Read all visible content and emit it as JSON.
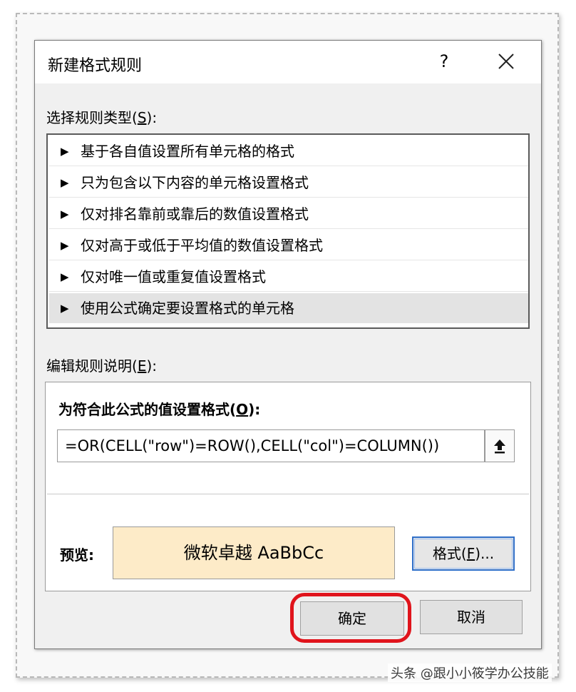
{
  "dialog": {
    "title": "新建格式规则",
    "help_label": "?",
    "close_icon": "close-icon"
  },
  "rule_types": {
    "label_text": "选择规则类型(",
    "label_key": "S",
    "label_end": "):",
    "items": [
      {
        "label": "基于各自值设置所有单元格的格式"
      },
      {
        "label": "只为包含以下内容的单元格设置格式"
      },
      {
        "label": "仅对排名靠前或靠后的数值设置格式"
      },
      {
        "label": "仅对高于或低于平均值的数值设置格式"
      },
      {
        "label": "仅对唯一值或重复值设置格式"
      },
      {
        "label": "使用公式确定要设置格式的单元格",
        "selected": true
      }
    ],
    "arrow_glyph": "▶"
  },
  "edit": {
    "label_text": "编辑规则说明(",
    "label_key": "E",
    "label_end": "):",
    "formula_label_text": "为符合此公式的值设置格式(",
    "formula_label_key": "O",
    "formula_label_end": "):",
    "formula_value": "=OR(CELL(\"row\")=ROW(),CELL(\"col\")=COLUMN())",
    "collapse_icon": "upload-arrow-icon",
    "preview_label": "预览:",
    "preview_text": "微软卓越  AaBbCc",
    "preview_fill": "#fdebc8",
    "format_button_text": "格式(",
    "format_button_key": "F",
    "format_button_end": ")..."
  },
  "buttons": {
    "ok": "确定",
    "cancel": "取消"
  },
  "highlight_color": "#e0141c",
  "watermark": "头条 @跟小小筱学办公技能"
}
